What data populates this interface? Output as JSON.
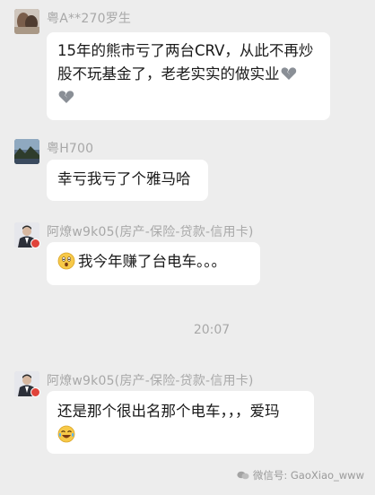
{
  "chat": {
    "messages": [
      {
        "sender": "粤A**270罗生",
        "text": "15年的熊市亏了两台CRV，从此不再炒股不玩基金了，老老实实的做实业",
        "emojis": [
          "broken-heart",
          "broken-heart"
        ]
      },
      {
        "sender": "粤H700",
        "text": "幸亏我亏了个雅马哈"
      },
      {
        "sender": "阿燎w9k05(房产-保险-贷款-信用卡)",
        "prefix_emoji": "astonished-face",
        "text": "我今年赚了台电车。。。"
      },
      {
        "sender": "阿燎w9k05(房产-保险-贷款-信用卡)",
        "text": "还是那个很出名那个电车，，，爱玛",
        "suffix_emoji": "tears-of-joy"
      }
    ],
    "timestamp": "20:07"
  },
  "watermark": {
    "text": "微信号: GaoXiao_www"
  }
}
